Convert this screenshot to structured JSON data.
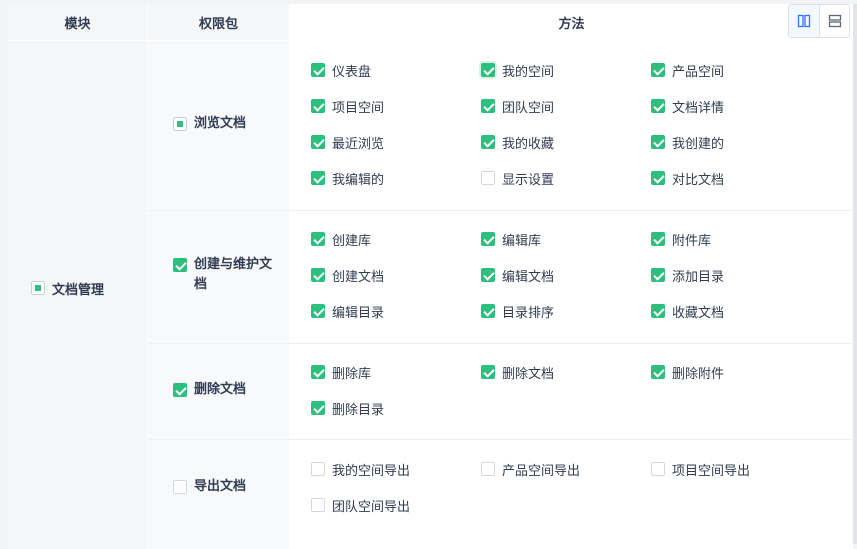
{
  "headers": {
    "module": "模块",
    "package": "权限包",
    "method": "方法"
  },
  "toolbar": {
    "column_view_icon": "column-layout-icon",
    "row_view_icon": "row-layout-icon",
    "active_color": "#3370ff"
  },
  "colors": {
    "check": "#2ebf7f"
  },
  "module": {
    "label": "文档管理",
    "state": "partial"
  },
  "packages": [
    {
      "label": "浏览文档",
      "state": "partial",
      "methods": [
        {
          "label": "仪表盘",
          "checked": true
        },
        {
          "label": "我的空间",
          "checked": true
        },
        {
          "label": "产品空间",
          "checked": true
        },
        {
          "label": "项目空间",
          "checked": true
        },
        {
          "label": "团队空间",
          "checked": true
        },
        {
          "label": "文档详情",
          "checked": true
        },
        {
          "label": "最近浏览",
          "checked": true
        },
        {
          "label": "我的收藏",
          "checked": true
        },
        {
          "label": "我创建的",
          "checked": true
        },
        {
          "label": "我编辑的",
          "checked": true
        },
        {
          "label": "显示设置",
          "checked": false
        },
        {
          "label": "对比文档",
          "checked": true
        }
      ]
    },
    {
      "label": "创建与维护文档",
      "state": "checked",
      "methods": [
        {
          "label": "创建库",
          "checked": true
        },
        {
          "label": "编辑库",
          "checked": true
        },
        {
          "label": "附件库",
          "checked": true
        },
        {
          "label": "创建文档",
          "checked": true
        },
        {
          "label": "编辑文档",
          "checked": true
        },
        {
          "label": "添加目录",
          "checked": true
        },
        {
          "label": "编辑目录",
          "checked": true
        },
        {
          "label": "目录排序",
          "checked": true
        },
        {
          "label": "收藏文档",
          "checked": true
        }
      ]
    },
    {
      "label": "删除文档",
      "state": "checked",
      "methods": [
        {
          "label": "删除库",
          "checked": true
        },
        {
          "label": "删除文档",
          "checked": true
        },
        {
          "label": "删除附件",
          "checked": true
        },
        {
          "label": "删除目录",
          "checked": true
        }
      ]
    },
    {
      "label": "导出文档",
      "state": "unchecked",
      "methods": [
        {
          "label": "我的空间导出",
          "checked": false
        },
        {
          "label": "产品空间导出",
          "checked": false
        },
        {
          "label": "项目空间导出",
          "checked": false
        },
        {
          "label": "团队空间导出",
          "checked": false
        }
      ]
    }
  ]
}
